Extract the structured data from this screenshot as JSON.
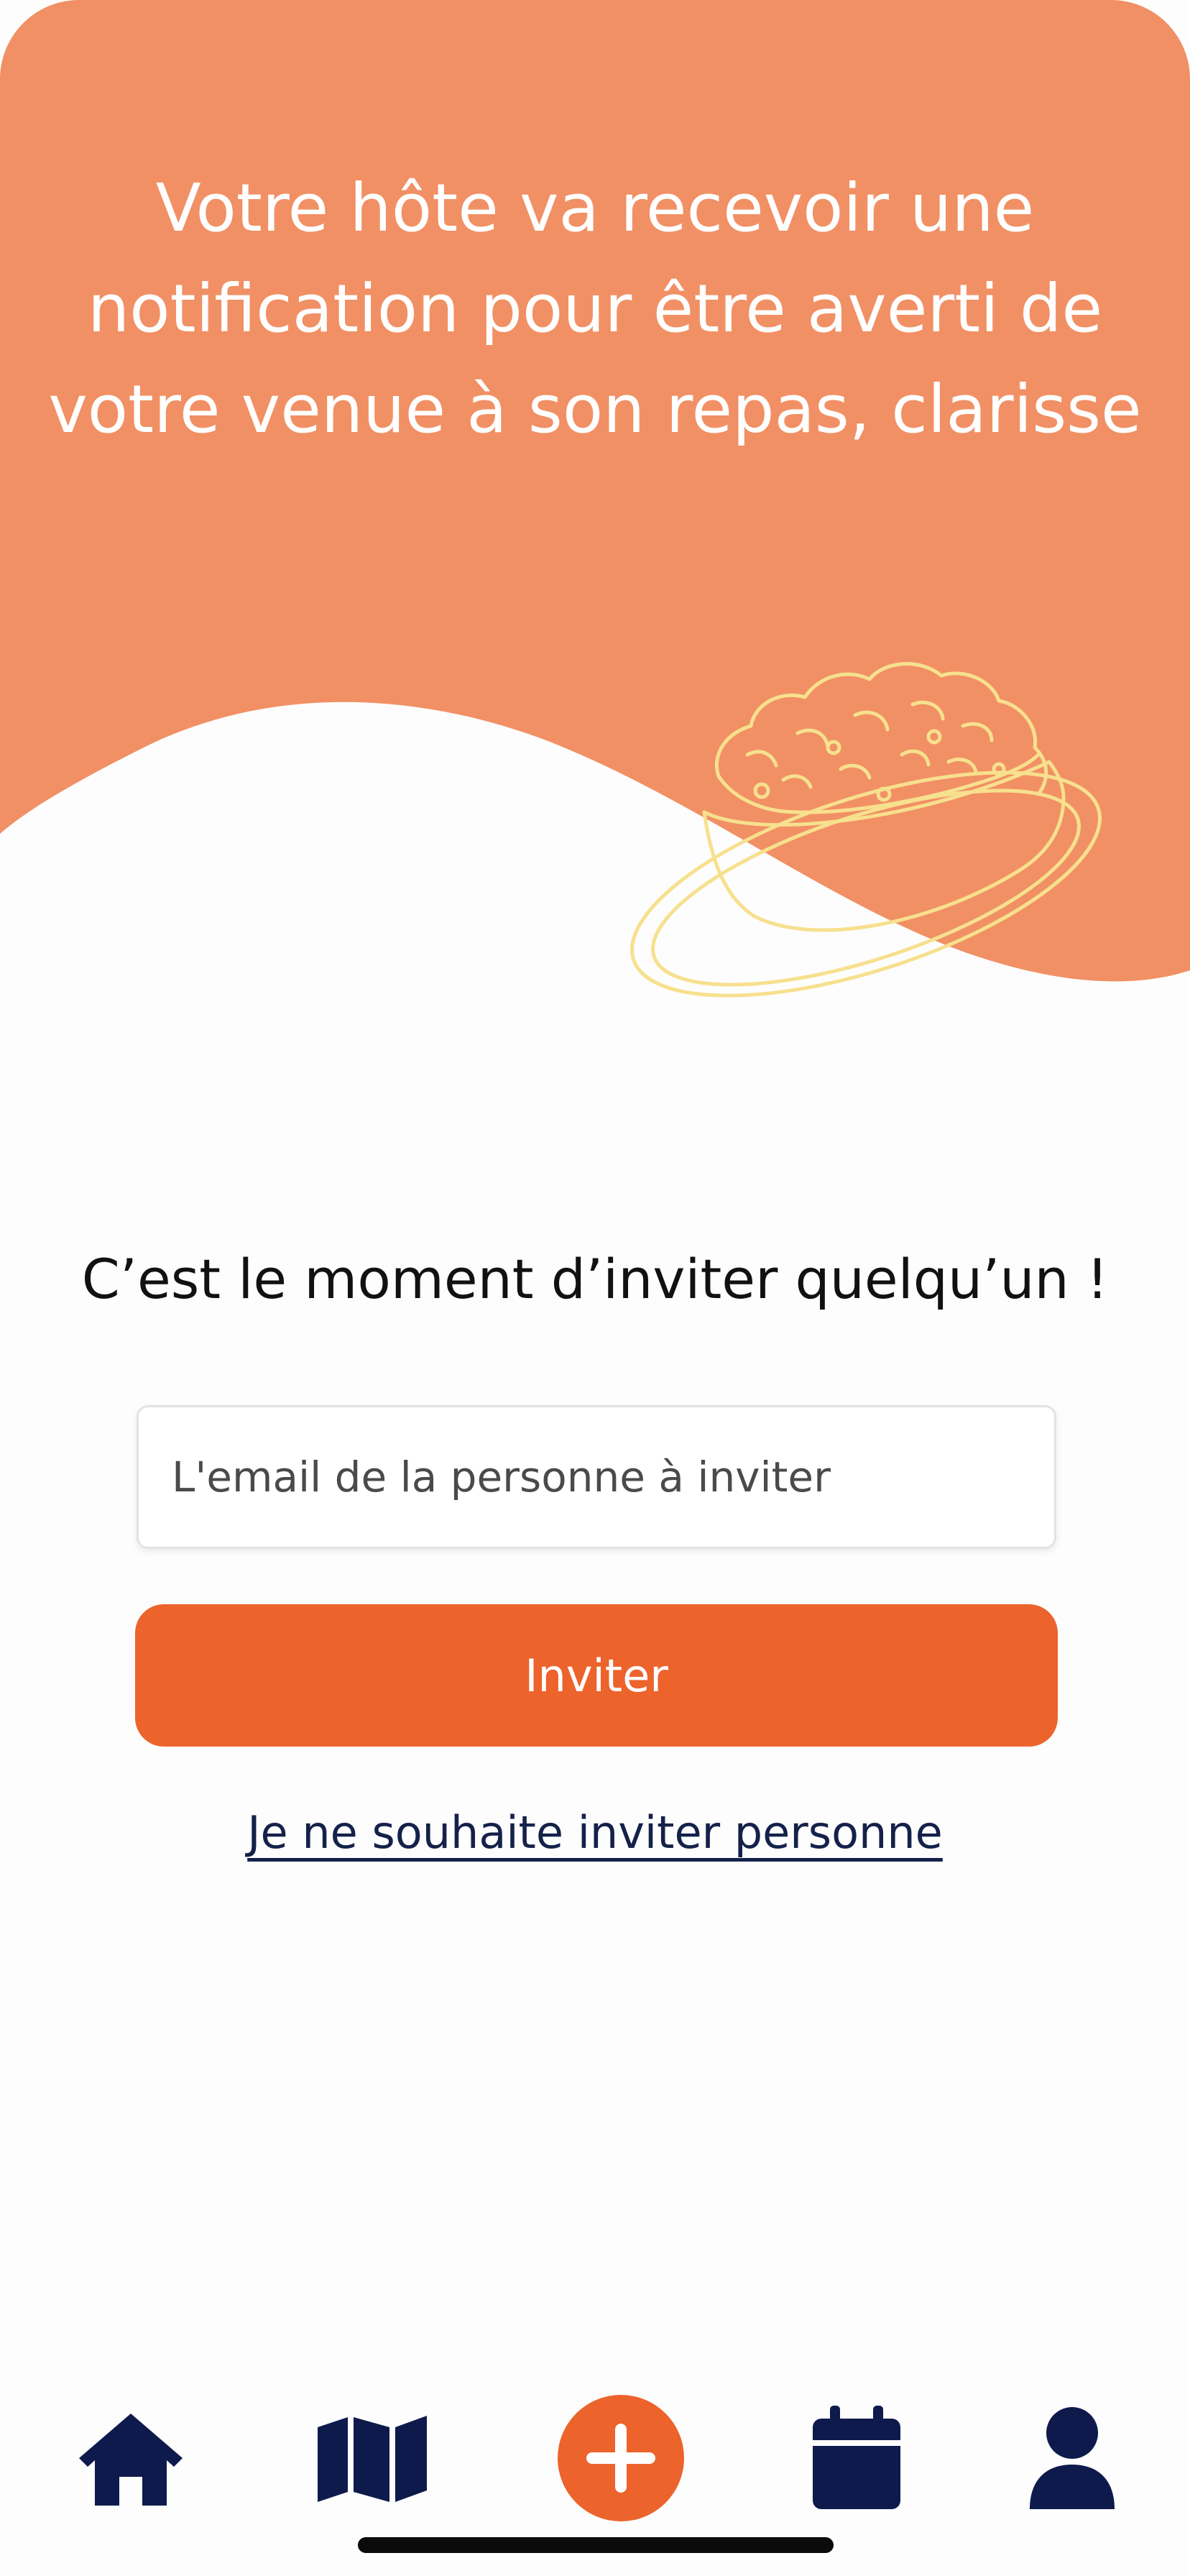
{
  "hero": {
    "title": "Votre hôte va recevoir une notification pour être averti de votre venue à son repas, clarisse",
    "illustration_icon": "dish-illustration",
    "background_color": "#f19064"
  },
  "invite": {
    "heading": "C’est le moment d’inviter quelqu’un !",
    "email_placeholder": "L'email de la personne à inviter",
    "email_value": "",
    "button_label": "Inviter",
    "skip_link": "Je ne souhaite inviter personne",
    "accent_color": "#ec632c"
  },
  "tabbar": {
    "items": [
      {
        "name": "home",
        "icon": "home-icon"
      },
      {
        "name": "map",
        "icon": "map-icon"
      },
      {
        "name": "add",
        "icon": "plus-circle-icon"
      },
      {
        "name": "calendar",
        "icon": "calendar-icon"
      },
      {
        "name": "profile",
        "icon": "user-icon"
      }
    ],
    "icon_color": "#0e1a4c"
  }
}
